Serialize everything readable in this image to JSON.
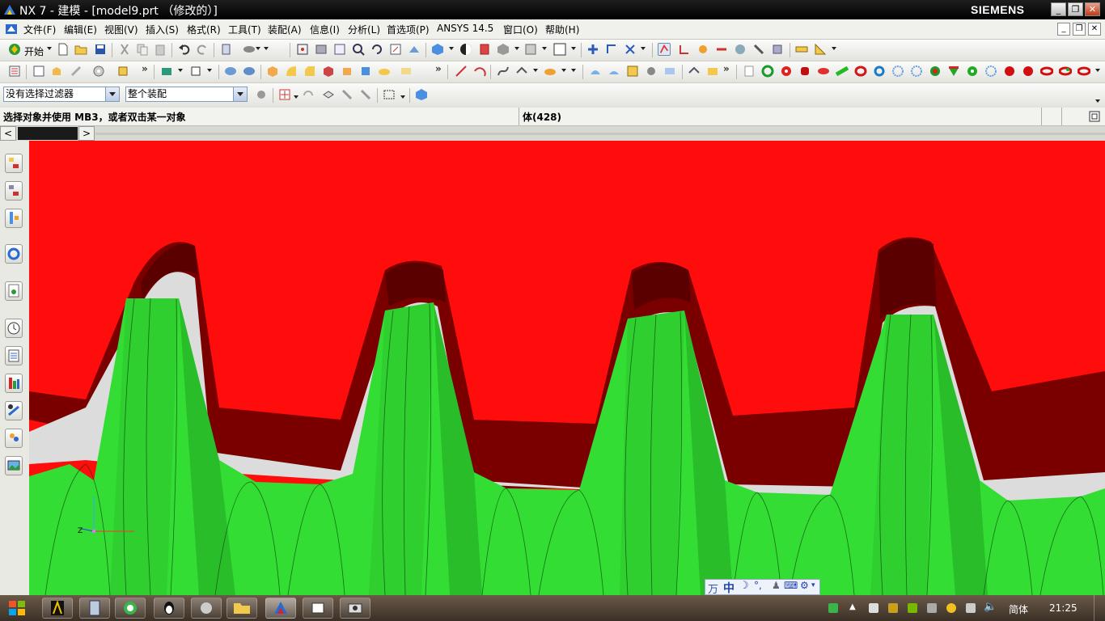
{
  "window": {
    "title": "NX 7 - 建模 - [model9.prt （修改的）]",
    "brand": "SIEMENS"
  },
  "menu": {
    "items": [
      "文件(F)",
      "编辑(E)",
      "视图(V)",
      "插入(S)",
      "格式(R)",
      "工具(T)",
      "装配(A)",
      "信息(I)",
      "分析(L)",
      "首选项(P)",
      "ANSYS 14.5",
      "窗口(O)",
      "帮助(H)"
    ]
  },
  "toolbar1": {
    "start_label": "开始"
  },
  "selection": {
    "filter_value": "没有选择过滤器",
    "scope_value": "整个装配"
  },
  "status": {
    "prompt": "选择对象并使用 MB3，或者双击某一对象",
    "selection_info": "体(428)"
  },
  "ime": {
    "label": "中"
  },
  "tray": {
    "language": "简体",
    "clock": "21:25"
  },
  "colors": {
    "background": "#ff0d0d",
    "tooth_green": "#33dd33",
    "tooth_dark_red": "#7a0000"
  }
}
